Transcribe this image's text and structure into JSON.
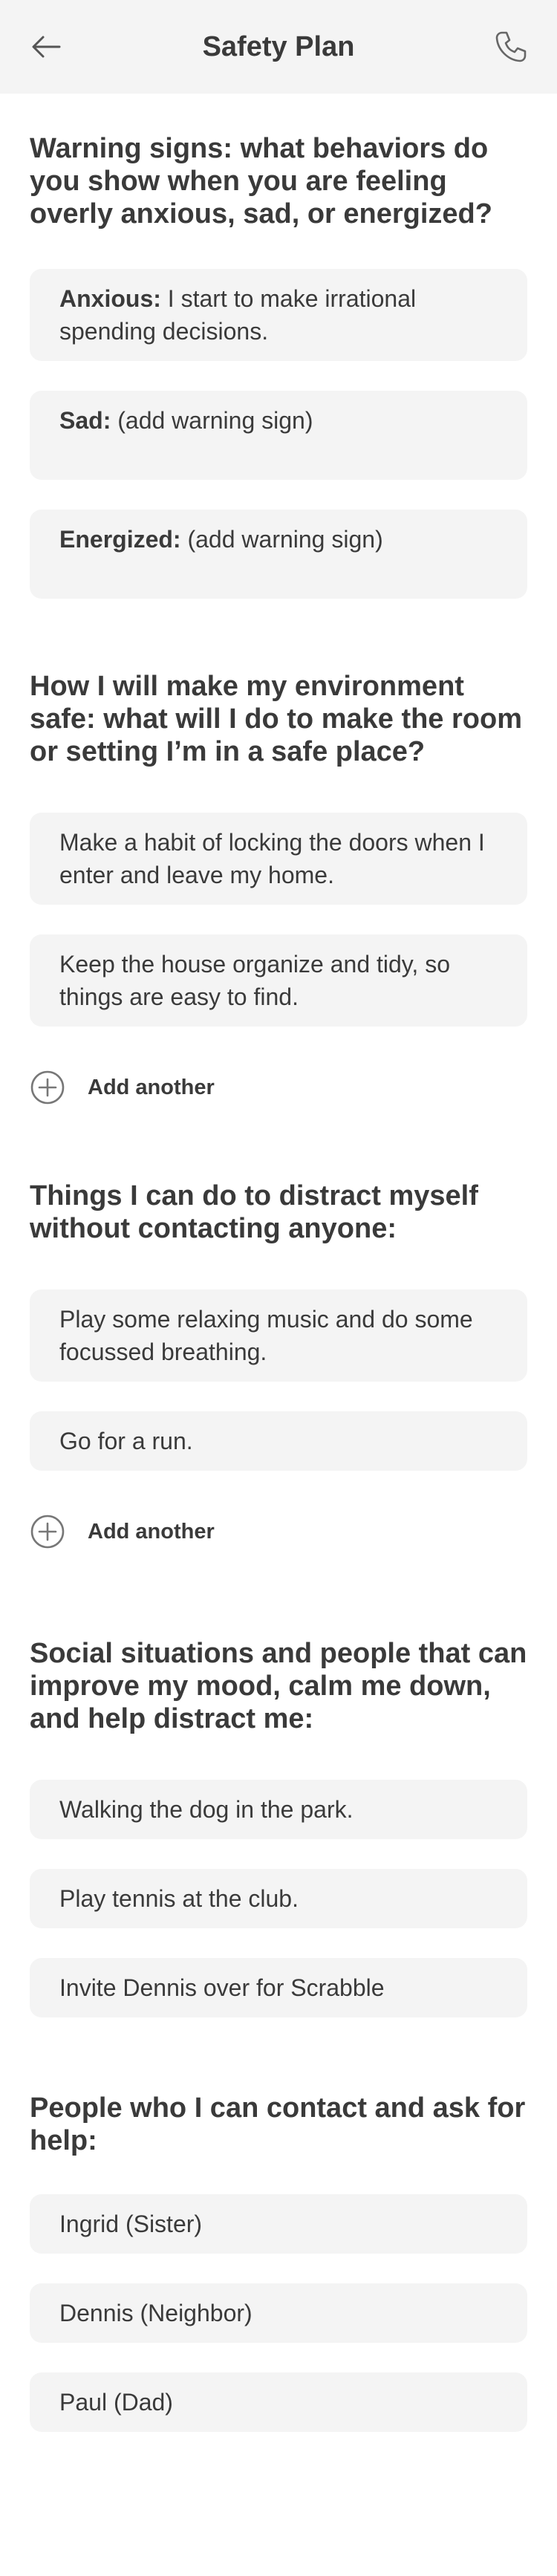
{
  "header": {
    "title": "Safety Plan",
    "back_icon": "arrow-left-icon",
    "call_icon": "phone-icon"
  },
  "warning_signs": {
    "title": "Warning signs: what behaviors do you show when you are feeling overly anxious, sad, or energized?",
    "items": [
      {
        "label": "Anxious:",
        "text": "I start to make irrational spending decisions."
      },
      {
        "label": "Sad:",
        "text": "(add warning sign)"
      },
      {
        "label": "Energized:",
        "text": "(add warning sign)"
      }
    ]
  },
  "environment": {
    "title": "How I will make my environment safe: what will I do to make the room or setting I’m in a safe place?",
    "items": [
      "Make a habit of locking the doors when I enter and leave my home.",
      "Keep the house organize and tidy, so things are easy to find."
    ],
    "add_label": "Add another"
  },
  "distract": {
    "title": "Things I can do to distract myself without contacting anyone:",
    "items": [
      "Play some relaxing music and do some focussed breathing.",
      "Go for a run."
    ],
    "add_label": "Add another"
  },
  "social": {
    "title": "Social situations and people that can improve my mood, calm me down, and help distract me:",
    "items": [
      "Walking the dog in the park.",
      "Play tennis at the club.",
      "Invite Dennis over for Scrabble"
    ]
  },
  "contacts": {
    "title": "People who I can contact and ask for help:",
    "items": [
      "Ingrid (Sister)",
      "Dennis (Neighbor)",
      "Paul (Dad)"
    ]
  },
  "colors": {
    "background": "#ffffff",
    "card": "#f4f4f4",
    "header": "#f4f4f4",
    "text": "#3a3a3a"
  }
}
